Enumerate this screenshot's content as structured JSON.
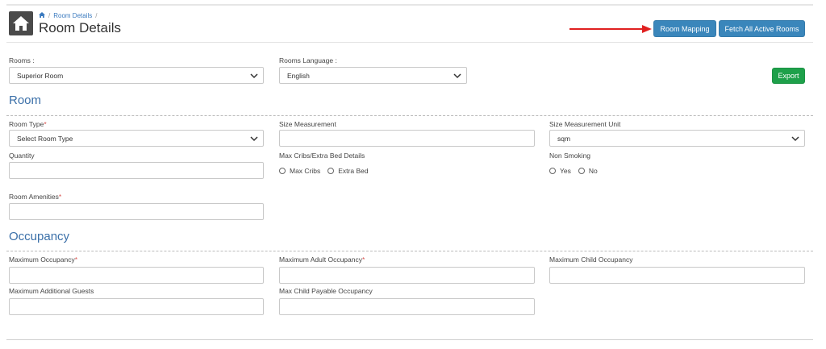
{
  "header": {
    "breadcrumb": {
      "current": "Room Details"
    },
    "title": "Room Details",
    "buttons": {
      "room_mapping": "Room Mapping",
      "fetch_all": "Fetch All Active Rooms"
    }
  },
  "filters": {
    "rooms_label": "Rooms :",
    "rooms_value": "Superior Room",
    "language_label": "Rooms Language :",
    "language_value": "English",
    "export_label": "Export"
  },
  "room_section": {
    "title": "Room",
    "room_type_label": "Room Type",
    "room_type_value": "Select Room Type",
    "size_measurement_label": "Size Measurement",
    "size_unit_label": "Size Measurement Unit",
    "size_unit_value": "sqm",
    "quantity_label": "Quantity",
    "max_cribs_label": "Max Cribs/Extra Bed Details",
    "max_cribs_option": "Max Cribs",
    "extra_bed_option": "Extra Bed",
    "non_smoking_label": "Non Smoking",
    "yes_option": "Yes",
    "no_option": "No",
    "amenities_label": "Room Amenities"
  },
  "occupancy_section": {
    "title": "Occupancy",
    "max_occupancy_label": "Maximum Occupancy",
    "max_adult_label": "Maximum Adult Occupancy",
    "max_child_label": "Maximum Child Occupancy",
    "max_additional_label": "Maximum Additional Guests",
    "max_child_payable_label": "Max Child Payable Occupancy"
  },
  "required_marker": "*",
  "colors": {
    "accent": "#3a86bb",
    "export": "#1ea04a",
    "section_title": "#3a6fa8",
    "required": "#d9534f",
    "arrow": "#e02020"
  },
  "icons": {
    "home": "home-icon",
    "breadcrumb_home": "home-small-icon",
    "select": "chevron-down-icon"
  }
}
